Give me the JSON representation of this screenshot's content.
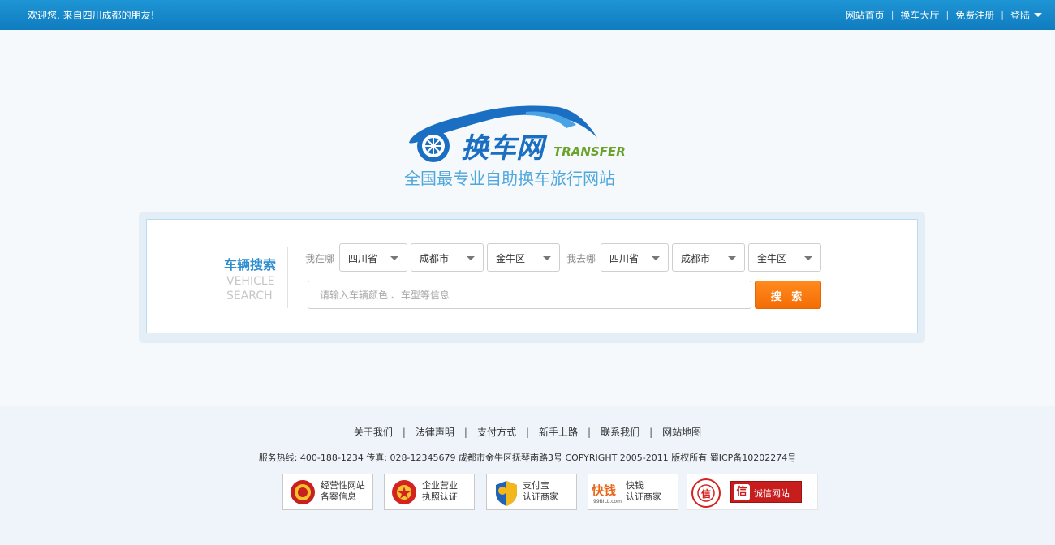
{
  "topbar": {
    "welcome": "欢迎您, 来自四川成都的朋友!",
    "nav": [
      "网站首页",
      "换车大厅",
      "免费注册",
      "登陆"
    ]
  },
  "logo": {
    "name": "换车网",
    "english": "TRANSFER",
    "tagline": "全国最专业自助换车旅行网站"
  },
  "search": {
    "title": "车辆搜索",
    "subtitle_line1": "VEHICLE",
    "subtitle_line2": "SEARCH",
    "from_label": "我在哪",
    "to_label": "我去哪",
    "from": {
      "province": "四川省",
      "city": "成都市",
      "district": "金牛区"
    },
    "to": {
      "province": "四川省",
      "city": "成都市",
      "district": "金牛区"
    },
    "placeholder": "请输入车辆颜色 、车型等信息",
    "button": "搜 索"
  },
  "footer": {
    "links": [
      "关于我们",
      "法律声明",
      "支付方式",
      "新手上路",
      "联系我们",
      "网站地图"
    ],
    "info": "服务热线: 400-188-1234  传真: 028-12345679  成都市金牛区抚琴南路3号  COPYRIGHT 2005-2011   版权所有  蜀ICP备10202274号",
    "badges": [
      {
        "line1": "经营性网站",
        "line2": "备案信息"
      },
      {
        "line1": "企业营业",
        "line2": "执照认证"
      },
      {
        "line1": "支付宝",
        "line2": "认证商家"
      },
      {
        "line1": "快钱",
        "line2": "认证商家",
        "logo": "快钱",
        "logo_sub": "99BILL.com"
      },
      {
        "label": "诚信网站",
        "seal": "信"
      }
    ]
  },
  "colors": {
    "topbar": "#1487c7",
    "accent": "#2f8ed0",
    "button": "#f36d05",
    "logo_green": "#6aa32b"
  }
}
